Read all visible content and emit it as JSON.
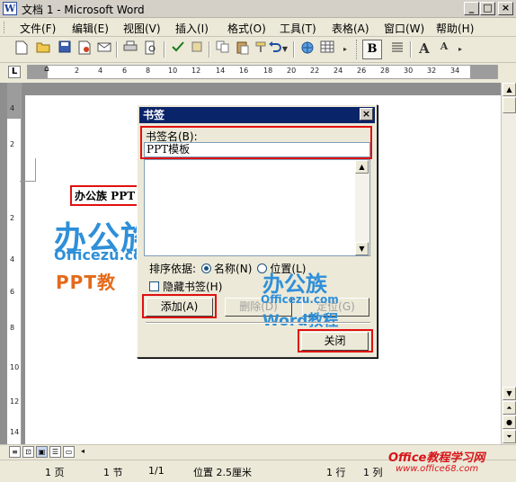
{
  "window": {
    "title": "文档 1 - Microsoft Word",
    "app_icon": "W",
    "minimize": "_",
    "maximize": "□",
    "close": "×"
  },
  "menu": [
    "文件(F)",
    "编辑(E)",
    "视图(V)",
    "插入(I)",
    "格式(O)",
    "工具(T)",
    "表格(A)",
    "窗口(W)",
    "帮助(H)"
  ],
  "toolbar": {
    "icons": [
      "new-doc-icon",
      "open-icon",
      "save-icon",
      "permission-icon",
      "email-icon",
      "print-icon",
      "print-preview-icon",
      "spelling-icon",
      "research-icon",
      "copy-icon",
      "paste-icon",
      "format-painter-icon",
      "undo-icon",
      "hyperlink-icon",
      "table-icon"
    ],
    "bold": "B",
    "grow_font": "A",
    "shrink_font": "A"
  },
  "ruler": {
    "corner": "L",
    "labels": [
      "2",
      "4",
      "6",
      "8",
      "10",
      "12",
      "14",
      "16",
      "18",
      "20",
      "22",
      "24",
      "26",
      "28",
      "30",
      "32",
      "34"
    ],
    "vertical_labels": [
      "4",
      "2",
      "2",
      "4",
      "6",
      "8",
      "10",
      "12",
      "14"
    ]
  },
  "document": {
    "text": "办公族 PPT",
    "logo_cn": "办公族",
    "logo_url": "Officezu.com",
    "logo_ppt": "PPT教"
  },
  "dialog": {
    "title": "书签",
    "close": "×",
    "name_label": "书签名(B):",
    "name_value": "PPT模板",
    "sort_label": "排序依据:",
    "sort_name": "名称(N)",
    "sort_position": "位置(L)",
    "sort_selected": "名称(N)",
    "hidden_label": "隐藏书签(H)",
    "hidden_checked": false,
    "add_button": "添加(A)",
    "delete_button": "删除(D)",
    "goto_button": "定位(G)",
    "close_button": "关闭",
    "logo_cn": "办公族",
    "logo_url": "Officezu.com",
    "logo_word": "Word教程"
  },
  "statusbar": {
    "page": "1 页",
    "section": "1 节",
    "page_of": "1/1",
    "position": "位置 2.5厘米",
    "line": "1 行",
    "column": "1 列"
  },
  "watermark": {
    "text": "Office教程学习网",
    "url": "www.office68.com"
  }
}
